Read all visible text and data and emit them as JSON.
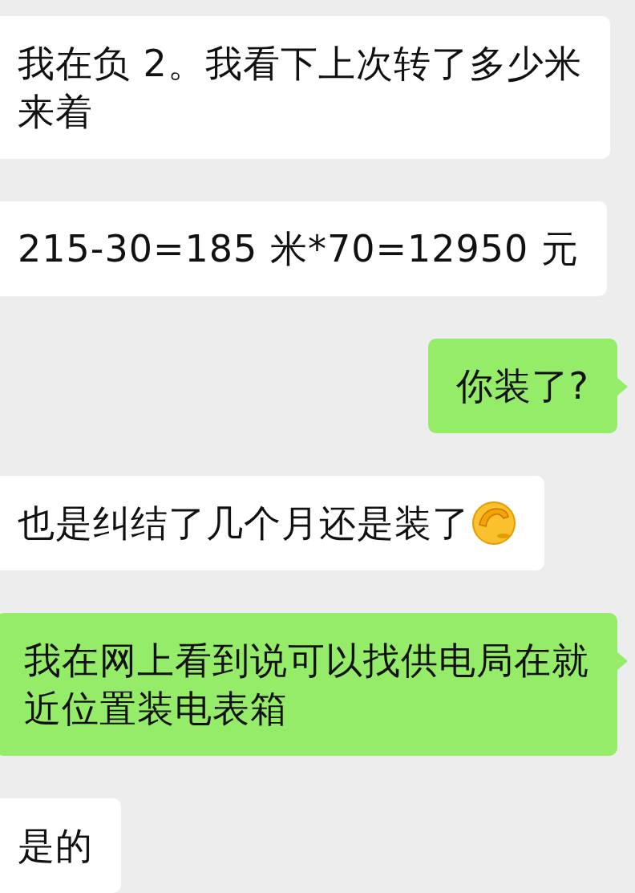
{
  "messages": [
    {
      "kind": "received",
      "lines": [
        "我在负 2。我看下上次转了多少米",
        "来着"
      ]
    },
    {
      "kind": "received",
      "lines": [
        "215-30=185 米*70=12950 元"
      ]
    },
    {
      "kind": "sent",
      "lines": [
        "你装了?"
      ]
    },
    {
      "kind": "received",
      "lines": [
        "也是纠结了几个月还是装了"
      ],
      "has_emoji": true
    },
    {
      "kind": "sent",
      "lines": [
        "我在网上看到说可以找供电局在就",
        "近位置装电表箱"
      ]
    },
    {
      "kind": "received",
      "lines": [
        "是的"
      ]
    }
  ]
}
